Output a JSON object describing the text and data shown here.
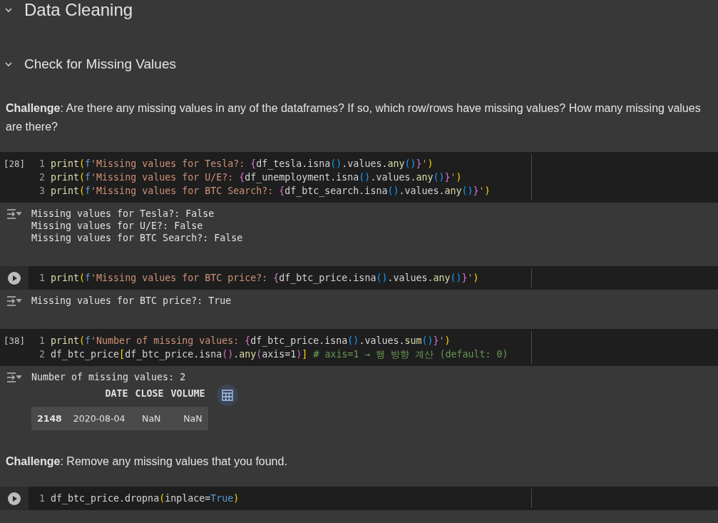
{
  "blocks": [
    {
      "kind": "heading1",
      "text": "Data Cleaning",
      "expanded": true
    },
    {
      "kind": "heading2",
      "text": "Check for Missing Values",
      "expanded": true
    },
    {
      "kind": "markdown",
      "text": "**Challenge**: Are there any missing values in any of the dataframes? If so, which row/rows have missing values? How many missing values are there?"
    },
    {
      "kind": "code",
      "prompt": "[28]",
      "lines": [
        {
          "number": "1",
          "tokens": [
            {
              "text": "print",
              "kind": "fn"
            },
            {
              "text": "(",
              "kind": "b1"
            },
            {
              "text": "f",
              "kind": "kw"
            },
            {
              "text": "'Missing values for Tesla?: ",
              "kind": "str"
            },
            {
              "text": "{",
              "kind": "b2"
            },
            {
              "text": "df_tesla.isna",
              "kind": "plain"
            },
            {
              "text": "()",
              "kind": "b3"
            },
            {
              "text": ".values.",
              "kind": "plain"
            },
            {
              "text": "any",
              "kind": "fn"
            },
            {
              "text": "()",
              "kind": "b3"
            },
            {
              "text": "}",
              "kind": "b2"
            },
            {
              "text": "'",
              "kind": "str"
            },
            {
              "text": ")",
              "kind": "b1"
            }
          ]
        },
        {
          "number": "2",
          "tokens": [
            {
              "text": "print",
              "kind": "fn"
            },
            {
              "text": "(",
              "kind": "b1"
            },
            {
              "text": "f",
              "kind": "kw"
            },
            {
              "text": "'Missing values for U/E?: ",
              "kind": "str"
            },
            {
              "text": "{",
              "kind": "b2"
            },
            {
              "text": "df_unemployment.isna",
              "kind": "plain"
            },
            {
              "text": "()",
              "kind": "b3"
            },
            {
              "text": ".values.",
              "kind": "plain"
            },
            {
              "text": "any",
              "kind": "fn"
            },
            {
              "text": "()",
              "kind": "b3"
            },
            {
              "text": "}",
              "kind": "b2"
            },
            {
              "text": "'",
              "kind": "str"
            },
            {
              "text": ")",
              "kind": "b1"
            }
          ]
        },
        {
          "number": "3",
          "tokens": [
            {
              "text": "print",
              "kind": "fn"
            },
            {
              "text": "(",
              "kind": "b1"
            },
            {
              "text": "f",
              "kind": "kw"
            },
            {
              "text": "'Missing values for BTC Search?: ",
              "kind": "str"
            },
            {
              "text": "{",
              "kind": "b2"
            },
            {
              "text": "df_btc_search.isna",
              "kind": "plain"
            },
            {
              "text": "()",
              "kind": "b3"
            },
            {
              "text": ".values.",
              "kind": "plain"
            },
            {
              "text": "any",
              "kind": "fn"
            },
            {
              "text": "()",
              "kind": "b3"
            },
            {
              "text": "}",
              "kind": "b2"
            },
            {
              "text": "'",
              "kind": "str"
            },
            {
              "text": ")",
              "kind": "b1"
            }
          ]
        }
      ],
      "output": {
        "lines": [
          "Missing values for Tesla?: False",
          "Missing values for U/E?: False",
          "Missing values for BTC Search?: False"
        ]
      }
    },
    {
      "kind": "code",
      "lines": [
        {
          "number": "1",
          "tokens": [
            {
              "text": "print",
              "kind": "fn"
            },
            {
              "text": "(",
              "kind": "b1"
            },
            {
              "text": "f",
              "kind": "kw"
            },
            {
              "text": "'Missing values for BTC price?: ",
              "kind": "str"
            },
            {
              "text": "{",
              "kind": "b2"
            },
            {
              "text": "df_btc_price.isna",
              "kind": "plain"
            },
            {
              "text": "()",
              "kind": "b3"
            },
            {
              "text": ".values.",
              "kind": "plain"
            },
            {
              "text": "any",
              "kind": "fn"
            },
            {
              "text": "()",
              "kind": "b3"
            },
            {
              "text": "}",
              "kind": "b2"
            },
            {
              "text": "'",
              "kind": "str"
            },
            {
              "text": ")",
              "kind": "b1"
            }
          ]
        }
      ],
      "output": {
        "lines": [
          "Missing values for BTC price?: True"
        ]
      }
    },
    {
      "kind": "code",
      "prompt": "[38]",
      "lines": [
        {
          "number": "1",
          "tokens": [
            {
              "text": "print",
              "kind": "fn"
            },
            {
              "text": "(",
              "kind": "b1"
            },
            {
              "text": "f",
              "kind": "kw"
            },
            {
              "text": "'Number of missing values: ",
              "kind": "str"
            },
            {
              "text": "{",
              "kind": "b2"
            },
            {
              "text": "df_btc_price.isna",
              "kind": "plain"
            },
            {
              "text": "()",
              "kind": "b3"
            },
            {
              "text": ".values.",
              "kind": "plain"
            },
            {
              "text": "sum",
              "kind": "fn"
            },
            {
              "text": "()",
              "kind": "b3"
            },
            {
              "text": "}",
              "kind": "b2"
            },
            {
              "text": "'",
              "kind": "str"
            },
            {
              "text": ")",
              "kind": "b1"
            }
          ]
        },
        {
          "number": "2",
          "tokens": [
            {
              "text": "df_btc_price",
              "kind": "plain"
            },
            {
              "text": "[",
              "kind": "b1"
            },
            {
              "text": "df_btc_price.isna",
              "kind": "plain"
            },
            {
              "text": "()",
              "kind": "b2"
            },
            {
              "text": ".",
              "kind": "plain"
            },
            {
              "text": "any",
              "kind": "fn"
            },
            {
              "text": "(",
              "kind": "b2"
            },
            {
              "text": "axis=1",
              "kind": "plain"
            },
            {
              "text": ")",
              "kind": "b2"
            },
            {
              "text": "]",
              "kind": "b1"
            },
            {
              "text": " # axis=1 → 행 방향 계산 (default: 0)",
              "kind": "comment"
            }
          ]
        }
      ],
      "output": {
        "lines": [
          "Number of missing values: 2"
        ],
        "table": {
          "columns": [
            "DATE",
            "CLOSE",
            "VOLUME"
          ],
          "rows": [
            {
              "index": "2148",
              "cells": [
                "2020-08-04",
                "NaN",
                "NaN"
              ]
            }
          ]
        }
      }
    },
    {
      "kind": "markdown",
      "text": "**Challenge**: Remove any missing values that you found."
    },
    {
      "kind": "code",
      "lines": [
        {
          "number": "1",
          "tokens": [
            {
              "text": "df_btc_price.dropna",
              "kind": "plain"
            },
            {
              "text": "(",
              "kind": "b1"
            },
            {
              "text": "inplace=",
              "kind": "plain"
            },
            {
              "text": "True",
              "kind": "kw"
            },
            {
              "text": ")",
              "kind": "b1"
            }
          ]
        }
      ]
    }
  ]
}
